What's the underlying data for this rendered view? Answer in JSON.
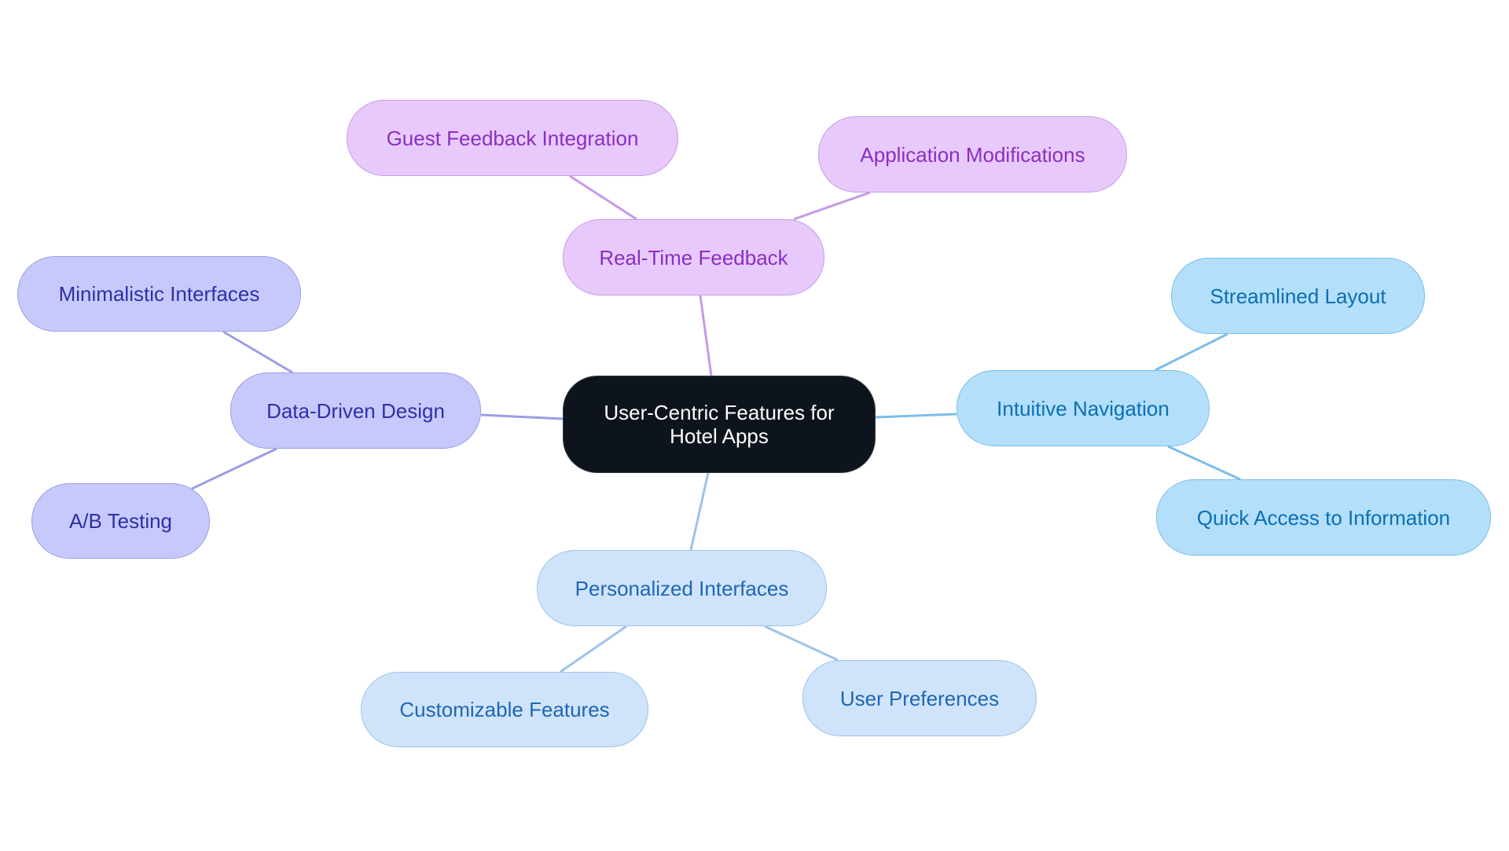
{
  "diagram": {
    "root": {
      "label": "User-Centric Features for Hotel Apps"
    },
    "branches": [
      {
        "id": "rtf",
        "label": "Real-Time Feedback",
        "color": "#c79ae8",
        "children": [
          {
            "id": "gfi",
            "label": "Guest Feedback Integration"
          },
          {
            "id": "am",
            "label": "Application Modifications"
          }
        ]
      },
      {
        "id": "ddd",
        "label": "Data-Driven Design",
        "color": "#9a9ee3",
        "children": [
          {
            "id": "mi",
            "label": "Minimalistic Interfaces"
          },
          {
            "id": "ab",
            "label": "A/B Testing"
          }
        ]
      },
      {
        "id": "in",
        "label": "Intuitive Navigation",
        "color": "#7cbde8",
        "children": [
          {
            "id": "sl",
            "label": "Streamlined Layout"
          },
          {
            "id": "qa",
            "label": "Quick Access to Information"
          }
        ]
      },
      {
        "id": "pi",
        "label": "Personalized Interfaces",
        "color": "#9cc3ea",
        "children": [
          {
            "id": "cf",
            "label": "Customizable Features"
          },
          {
            "id": "up",
            "label": "User Preferences"
          }
        ]
      }
    ]
  }
}
